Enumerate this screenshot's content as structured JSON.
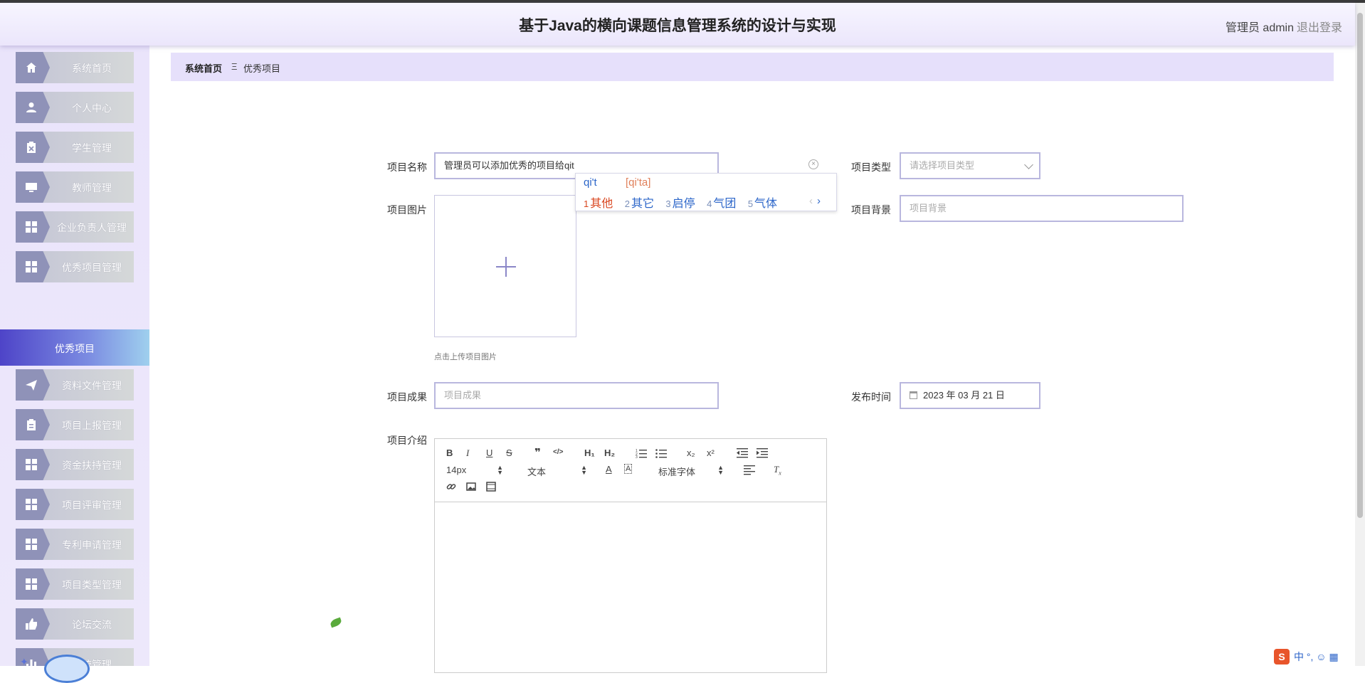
{
  "header": {
    "title": "基于Java的横向课题信息管理系统的设计与实现",
    "user": "管理员 admin",
    "logout": "退出登录"
  },
  "sidebar": {
    "items": [
      {
        "label": "系统首页",
        "icon": "home-icon"
      },
      {
        "label": "个人中心",
        "icon": "user-icon"
      },
      {
        "label": "学生管理",
        "icon": "clipboard-x-icon"
      },
      {
        "label": "教师管理",
        "icon": "monitor-icon"
      },
      {
        "label": "企业负责人管理",
        "icon": "grid-icon"
      },
      {
        "label": "优秀项目管理",
        "icon": "grid-icon"
      },
      {
        "label": "资料文件管理",
        "icon": "paper-plane-icon"
      },
      {
        "label": "项目上报管理",
        "icon": "clipboard-icon"
      },
      {
        "label": "资金扶持管理",
        "icon": "grid-icon"
      },
      {
        "label": "项目评审管理",
        "icon": "grid-icon"
      },
      {
        "label": "专利申请管理",
        "icon": "grid-icon"
      },
      {
        "label": "项目类型管理",
        "icon": "grid-icon"
      },
      {
        "label": "论坛交流",
        "icon": "thumbs-up-icon"
      },
      {
        "label": "系统管理",
        "icon": "bar-chart-icon"
      }
    ],
    "active_sub": "优秀项目"
  },
  "breadcrumb": {
    "home": "系统首页",
    "separator": "Ξ",
    "current": "优秀项目"
  },
  "form": {
    "name_label": "项目名称",
    "name_value": "管理员可以添加优秀的项目给qit",
    "type_label": "项目类型",
    "type_placeholder": "请选择项目类型",
    "image_label": "项目图片",
    "image_hint": "点击上传项目图片",
    "background_label": "项目背景",
    "background_placeholder": "项目背景",
    "result_label": "项目成果",
    "result_placeholder": "项目成果",
    "date_label": "发布时间",
    "date_value": "2023 年 03 月 21 日",
    "intro_label": "项目介绍"
  },
  "ime": {
    "pinyin": "qi't",
    "alternative": "[qi'ta]",
    "candidates": [
      {
        "n": "1",
        "text": "其他"
      },
      {
        "n": "2",
        "text": "其它"
      },
      {
        "n": "3",
        "text": "启停"
      },
      {
        "n": "4",
        "text": "气团"
      },
      {
        "n": "5",
        "text": "气体"
      }
    ],
    "prev": "‹",
    "next": "›"
  },
  "editor": {
    "toolbar_row1": [
      "B",
      "I",
      "U",
      "S",
      "❞",
      "</>",
      "H1",
      "H2",
      "ol",
      "ul",
      "x₂",
      "x²",
      "outdent",
      "indent"
    ],
    "size_select": "14px",
    "format_select": "文本",
    "font_select": "标准字体",
    "heading_label_1": "H₁",
    "heading_label_2": "H₂"
  },
  "tray": {
    "ime_logo": "S",
    "ime_mode": "中"
  },
  "colors": {
    "accent": "#8f92b8",
    "active_menu": "#4e44c8",
    "breadcrumb_bg": "#e6e0fb",
    "input_border": "#b9b7de"
  }
}
